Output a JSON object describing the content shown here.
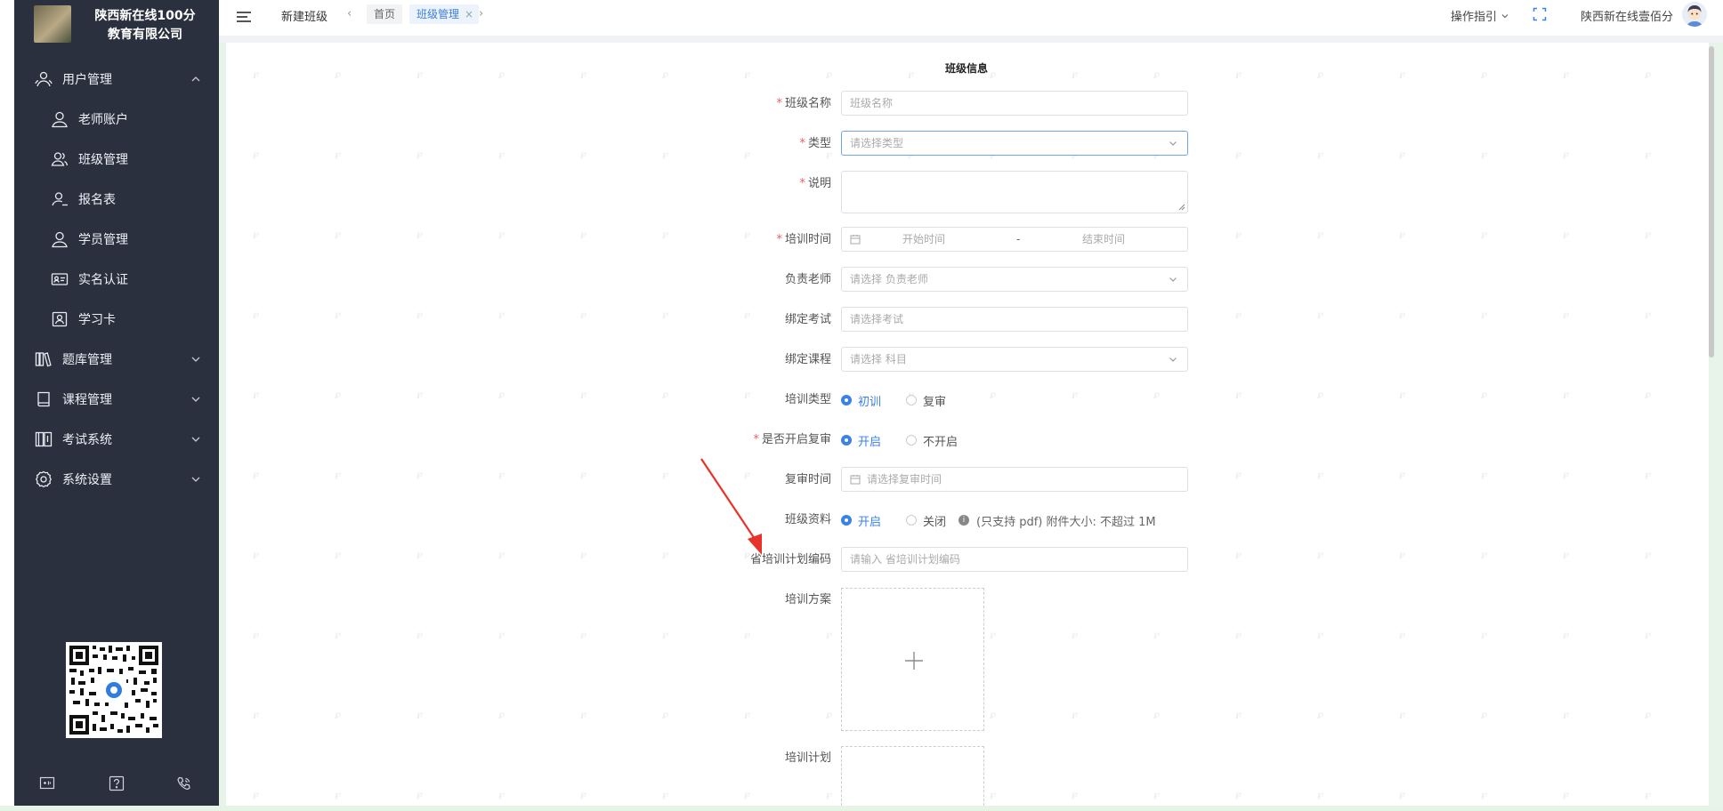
{
  "sidebar": {
    "company": [
      "陕西新在线100分",
      "教育有限公司"
    ],
    "items": [
      {
        "label": "用户管理",
        "icon": "user-group-icon",
        "expanded": true
      },
      {
        "label": "老师账户",
        "icon": "teacher-icon"
      },
      {
        "label": "班级管理",
        "icon": "class-icon"
      },
      {
        "label": "报名表",
        "icon": "signup-icon"
      },
      {
        "label": "学员管理",
        "icon": "student-icon"
      },
      {
        "label": "实名认证",
        "icon": "id-card-icon"
      },
      {
        "label": "学习卡",
        "icon": "study-card-icon"
      },
      {
        "label": "题库管理",
        "icon": "question-bank-icon",
        "expanded": false
      },
      {
        "label": "课程管理",
        "icon": "course-icon",
        "expanded": false
      },
      {
        "label": "考试系统",
        "icon": "exam-icon",
        "expanded": false
      },
      {
        "label": "系统设置",
        "icon": "settings-icon",
        "expanded": false
      }
    ],
    "bottom_icons": [
      "screen-icon",
      "help-icon",
      "phone-icon"
    ]
  },
  "topbar": {
    "page_title": "新建班级",
    "tabs": [
      {
        "label": "首页",
        "active": false
      },
      {
        "label": "班级管理",
        "active": true,
        "close": "×"
      }
    ],
    "nav_prev": "‹",
    "nav_next": "›",
    "guide_label": "操作指引",
    "user_name": "陕西新在线壹佰分"
  },
  "form": {
    "title": "班级信息",
    "class_name": {
      "label": "班级名称",
      "required": "*",
      "placeholder": "班级名称"
    },
    "type": {
      "label": "类型",
      "required": "*",
      "placeholder": "请选择类型"
    },
    "description": {
      "label": "说明",
      "required": "*",
      "value": ""
    },
    "training_time": {
      "label": "培训时间",
      "required": "*",
      "start_placeholder": "开始时间",
      "separator": "-",
      "end_placeholder": "结束时间"
    },
    "teacher": {
      "label": "负责老师",
      "placeholder": "请选择 负责老师"
    },
    "exam": {
      "label": "绑定考试",
      "placeholder": "请选择考试"
    },
    "course": {
      "label": "绑定课程",
      "placeholder": "请选择 科目"
    },
    "training_type": {
      "label": "培训类型",
      "options": [
        "初训",
        "复审"
      ],
      "selected": "初训"
    },
    "review_enabled": {
      "label": "是否开启复审",
      "required": "*",
      "options": [
        "开启",
        "不开启"
      ],
      "selected": "开启"
    },
    "review_time": {
      "label": "复审时间",
      "placeholder": "请选择复审时间"
    },
    "class_material": {
      "label": "班级资料",
      "options": [
        "开启",
        "关闭"
      ],
      "selected": "开启",
      "info": "i",
      "note": "(只支持 pdf) 附件大小: 不超过 1M"
    },
    "plan_code": {
      "label": "省培训计划编码",
      "placeholder": "请输入 省培训计划编码"
    },
    "training_scheme": {
      "label": "培训方案"
    },
    "training_plan": {
      "label": "培训计划"
    }
  },
  "colors": {
    "sidebar_bg": "#2b303f",
    "accent": "#3b82e8",
    "required": "#f25b5b",
    "arrow": "#e8332a"
  }
}
